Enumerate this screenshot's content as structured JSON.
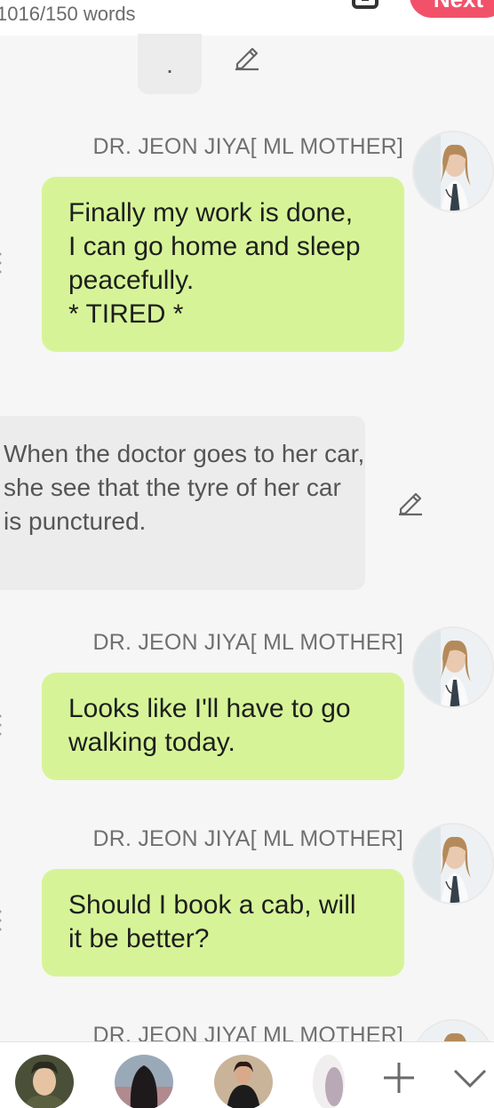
{
  "header": {
    "word_count": "1016/150 words",
    "next_label": "Next"
  },
  "narration": {
    "first": ".",
    "second": "When the doctor goes to her car, she see that the tyre of her car is punctured."
  },
  "messages": [
    {
      "speaker": "DR. JEON JIYA[ ML MOTHER]",
      "lines": [
        "Finally my work is done,",
        "I can go home and sleep",
        "peacefully.",
        "* TIRED *"
      ]
    },
    {
      "speaker": "DR. JEON JIYA[ ML MOTHER]",
      "lines": [
        "Looks like I'll have to go",
        "walking today."
      ]
    },
    {
      "speaker": "DR. JEON JIYA[ ML MOTHER]",
      "lines": [
        "Should I book a cab, will",
        "it be better?"
      ]
    },
    {
      "speaker": "DR. JEON JIYA[ ML MOTHER]",
      "lines": []
    }
  ],
  "icons": {
    "edit": "pencil-icon",
    "add": "plus-icon",
    "collapse": "chevron-down-icon",
    "toolbar": "calendar-icon"
  },
  "colors": {
    "bubble": "#d6f497",
    "narration": "#ececec",
    "accent": "#f2516a"
  }
}
